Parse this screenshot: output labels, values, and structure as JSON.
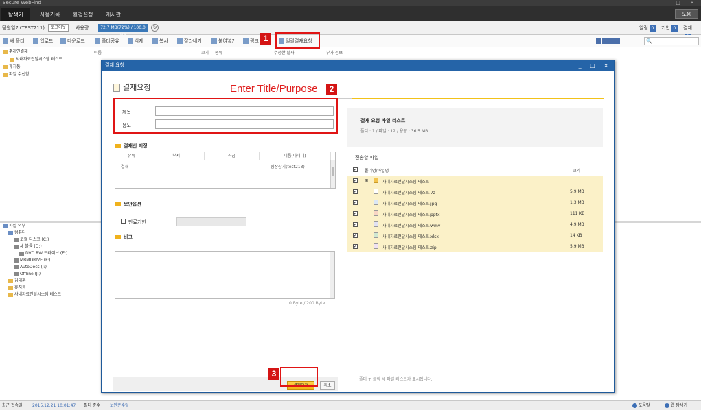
{
  "window": {
    "title": "Secure WebFind",
    "controls": "_ □ ×"
  },
  "menu": {
    "tabs": [
      "탐색기",
      "사용기록",
      "환경설정",
      "게시판"
    ],
    "help": "도움"
  },
  "userbar": {
    "user": "팀원일기(TEST211)",
    "logout": "로그아웃",
    "quota_label": "사용량",
    "quota_value": "72.7 MB(72%) / 100.0 MB",
    "buttons": [
      {
        "label": "알림",
        "badge": "0"
      },
      {
        "label": "기안",
        "badge": "0"
      },
      {
        "label": "결재",
        "badge": "0"
      }
    ]
  },
  "toolbar": {
    "items": [
      "새 폴더",
      "업로드",
      "다운로드",
      "폴더공유",
      "삭제",
      "복사",
      "잘라내기",
      "붙여넣기",
      "링크",
      "일괄결재요청"
    ]
  },
  "columns": [
    "이름",
    "크기",
    "종류",
    "수정한 날짜",
    "부가 정보"
  ],
  "tree_top": [
    "주개인결재",
    "사내자료전달시스템 테스트",
    "휴지통",
    "파일 수신함"
  ],
  "tree_bottom": [
    "파일 외부",
    "컴퓨터",
    "로컬 디스크 (C:)",
    "새 볼륨 (D:)",
    "DVD RW 드라이브 (E:)",
    "MBMDRIVE (F:)",
    "AutoDocs (I:)",
    "Offline (J:)",
    "김대훈",
    "휴지통",
    "사내자료전달시스템 테스트"
  ],
  "dialog": {
    "title": "결재 요청",
    "controls": "_ □ ×",
    "heading": "결재요청",
    "title_label": "제목",
    "purpose_label": "용도",
    "approver_section": "결재선 지정",
    "approver_columns": [
      "유류",
      "부서",
      "직급",
      "이름(아이디)"
    ],
    "approver_row": [
      "결재",
      "",
      "",
      "팀장상기(test213)"
    ],
    "security_section": "보안옵션",
    "expire_label": "만료기한",
    "note_section": "비고",
    "counter": "0 Byte / 200 Byte",
    "info_title": "결재 요청 파일 리스트",
    "info_detail": "폴더 : 1 / 파일 : 12 / 용량 : 36.5 MB",
    "transfer_label": "전송할 파일",
    "file_col_name": "폴더명/파일명",
    "file_col_size": "크기",
    "files": [
      {
        "name": "사내자료전달시스템 테스트",
        "size": "",
        "type": "folder"
      },
      {
        "name": "사내자료전달시스템 테스트.7z",
        "size": "5.9 MB",
        "type": "7z"
      },
      {
        "name": "사내자료전달시스템 테스트.jpg",
        "size": "1.3 MB",
        "type": "jpg"
      },
      {
        "name": "사내자료전달시스템 테스트.pptx",
        "size": "111 KB",
        "type": "pptx"
      },
      {
        "name": "사내자료전달시스템 테스트.wmv",
        "size": "4.9 MB",
        "type": "wmv"
      },
      {
        "name": "사내자료전달시스템 테스트.xlsx",
        "size": "14 KB",
        "type": "xlsx"
      },
      {
        "name": "사내자료전달시스템 테스트.zip",
        "size": "5.9 MB",
        "type": "zip"
      }
    ],
    "hint": "폴더 + 클릭 시 파일 리스트가 표시됩니다.",
    "submit": "결재요청",
    "cancel": "취소"
  },
  "annotations": {
    "step1": "1",
    "step2": "2",
    "step2_text": "Enter Title/Purpose",
    "step3": "3",
    "color": "#e01515"
  },
  "statusbar": {
    "last_login_label": "최근 접속일",
    "last_login_value": "2015.12.21 10:01:47",
    "security_label": "필터 준수",
    "security_value": "보안준수일",
    "help": "도움말",
    "guide": "웹 탐색기"
  }
}
